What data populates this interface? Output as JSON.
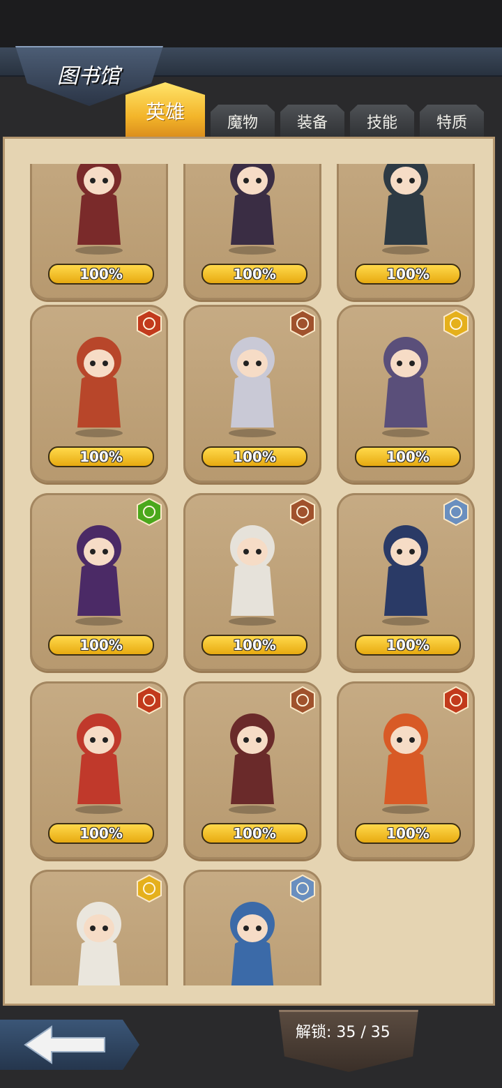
{
  "header": {
    "title": "图书馆"
  },
  "tabs": [
    {
      "label": "英雄",
      "active": true
    },
    {
      "label": "魔物",
      "active": false
    },
    {
      "label": "装备",
      "active": false
    },
    {
      "label": "技能",
      "active": false
    },
    {
      "label": "特质",
      "active": false
    }
  ],
  "heroes": [
    {
      "progress": "100%",
      "element": "none",
      "color": "#7a2a2a"
    },
    {
      "progress": "100%",
      "element": "none",
      "color": "#3a2d44"
    },
    {
      "progress": "100%",
      "element": "none",
      "color": "#2d3a44"
    },
    {
      "progress": "100%",
      "element": "fire",
      "color": "#b8462a"
    },
    {
      "progress": "100%",
      "element": "earth",
      "color": "#c9c9d6"
    },
    {
      "progress": "100%",
      "element": "light",
      "color": "#5a4f7a"
    },
    {
      "progress": "100%",
      "element": "nature",
      "color": "#4b2a66"
    },
    {
      "progress": "100%",
      "element": "earth",
      "color": "#e6e2da"
    },
    {
      "progress": "100%",
      "element": "water",
      "color": "#2a3a66"
    },
    {
      "progress": "100%",
      "element": "fire",
      "color": "#c0392b"
    },
    {
      "progress": "100%",
      "element": "earth",
      "color": "#6a2a2a"
    },
    {
      "progress": "100%",
      "element": "fire",
      "color": "#d85a26"
    },
    {
      "progress": "",
      "element": "light",
      "color": "#eae6dd"
    },
    {
      "progress": "",
      "element": "water",
      "color": "#3b6aa8"
    }
  ],
  "footer": {
    "unlock": "解锁: 35 / 35"
  }
}
